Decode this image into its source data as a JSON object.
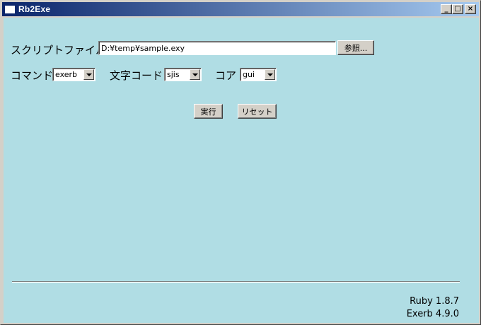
{
  "window": {
    "title": "Rb2Exe",
    "minimize_glyph": "_",
    "maximize_glyph": "□",
    "close_glyph": "×"
  },
  "form": {
    "script_file_label": "スクリプトファイル",
    "script_file_value": "D:¥temp¥sample.exy",
    "browse_button": "参照...",
    "command_label": "コマンド",
    "command_value": "exerb",
    "charcode_label": "文字コード",
    "charcode_value": "sjis",
    "core_label": "コア",
    "core_value": "gui",
    "run_button": "実行",
    "reset_button": "リセット"
  },
  "footer": {
    "ruby_version": "Ruby 1.8.7",
    "exerb_version": "Exerb 4.9.0"
  },
  "colors": {
    "titlebar_start": "#0a246a",
    "titlebar_end": "#a6caf0",
    "client_background": "#b0dde4"
  }
}
